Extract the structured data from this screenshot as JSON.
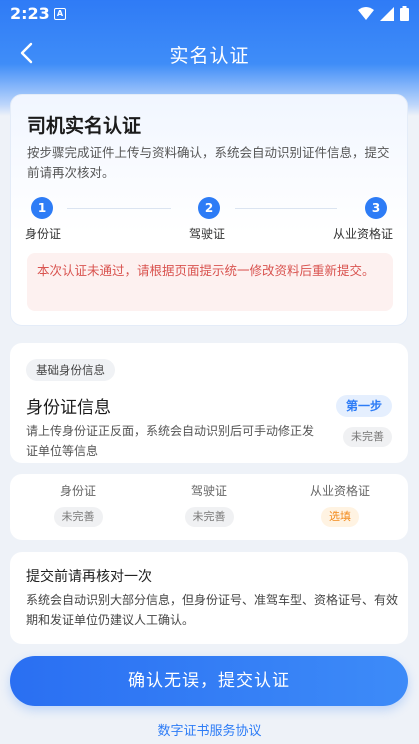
{
  "status_bar": {
    "time": "2:23",
    "notif_icon": "A"
  },
  "nav": {
    "title": "实名认证"
  },
  "intro": {
    "title": "司机实名认证",
    "description": "按步骤完成证件上传与资料确认，系统会自动识别证件信息，提交前请再次核对。",
    "steps": [
      {
        "num": "1",
        "label": "身份证"
      },
      {
        "num": "2",
        "label": "驾驶证"
      },
      {
        "num": "3",
        "label": "从业资格证"
      }
    ],
    "warning": "本次认证未通过，请根据页面提示统一修改资料后重新提交。"
  },
  "id_card": {
    "tag": "基础身份信息",
    "title": "身份证信息",
    "description": "请上传身份证正反面，系统会自动识别后可手动修正发证单位等信息",
    "step_badge": "第一步",
    "status_badge": "未完善"
  },
  "doc_tabs": [
    {
      "name": "身份证",
      "status": "未完善"
    },
    {
      "name": "驾驶证",
      "status": "未完善"
    },
    {
      "name": "从业资格证",
      "status": "选填"
    }
  ],
  "review": {
    "title": "提交前请再核对一次",
    "description": "系统会自动识别大部分信息，但身份证号、准驾车型、资格证号、有效期和发证单位仍建议人工确认。"
  },
  "submit_label": "确认无误，提交认证",
  "agreement_label": "数字证书服务协议",
  "colors": {
    "primary": "#2d7cf6",
    "warning": "#d9534f",
    "optional": "#f28b1e"
  }
}
